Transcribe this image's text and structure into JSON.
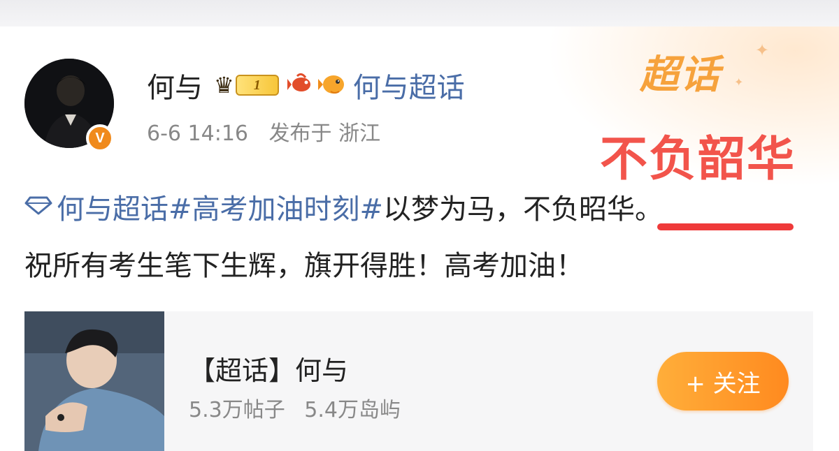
{
  "post": {
    "username": "何与",
    "level": "1",
    "topic_link": "何与超话",
    "time": "6-6 14:16",
    "location": "发布于 浙江",
    "text_line1_tags": [
      "何与超话",
      "#高考加油时刻#"
    ],
    "text_line1_plain_a": "以梦为马，不",
    "text_line1_underlined": "负昭华。",
    "text_line2": "祝所有考生笔下生辉，旗开得胜！高考加油！"
  },
  "overlay": {
    "logo": "超话",
    "title": "不负韶华"
  },
  "topic_card": {
    "title": "【超话】何与",
    "posts": "5.3万帖子",
    "members": "5.4万岛屿",
    "follow_label": "+ 关注"
  },
  "colors": {
    "link": "#4a6da7",
    "accent_orange": "#ff9a2a",
    "underline_red": "#ef3a3a",
    "overlay_red": "#f2544b"
  },
  "icons": [
    "crown-icon",
    "level-badge",
    "fish-icon",
    "pufferfish-icon",
    "diamond-icon",
    "verified-badge-icon"
  ]
}
